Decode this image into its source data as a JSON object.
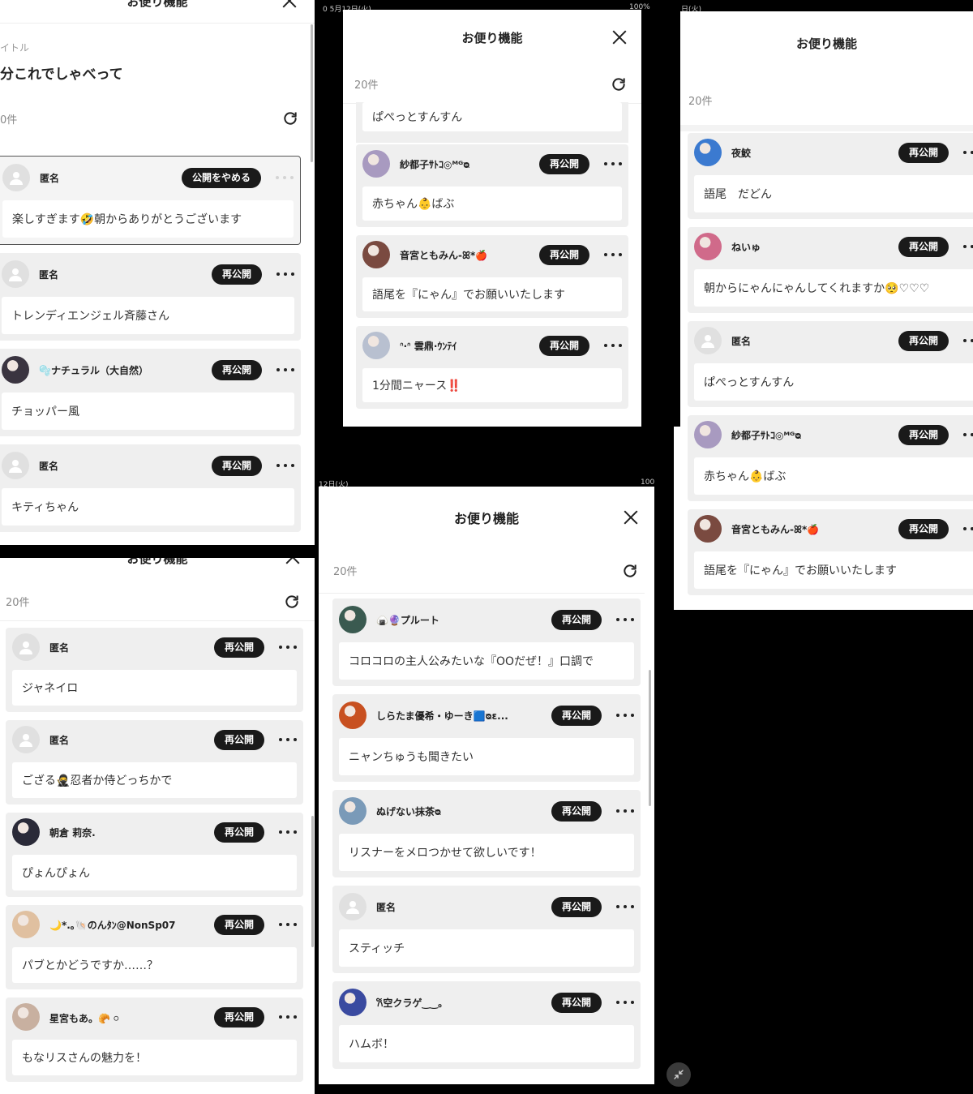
{
  "modal_title": "お便り機能",
  "count_label": "20件",
  "republish_label": "再公開",
  "stop_publish_label": "公開をやめる",
  "colors": {
    "pill": "#1a1a1a",
    "card": "#efefef",
    "bg": "#000000"
  },
  "status_bars": {
    "top_left": "0  5月12日(火)",
    "top_right": "100%",
    "top_far": "日(火)",
    "mid_left": "12日(火)",
    "mid_right": "100"
  },
  "panel1": {
    "header": "お便り機能",
    "title_label": "イトル",
    "title_value": "分これでしゃべって",
    "count": "0件",
    "items": [
      {
        "name": "匿名",
        "avatar": "anon",
        "button": "公開をやめる",
        "message": "楽しすぎます🤣朝からありがとうございます"
      },
      {
        "name": "匿名",
        "avatar": "anon",
        "button": "再公開",
        "message": "トレンディエンジェル斉藤さん"
      },
      {
        "name": "🫧ナチュラル（大自然）",
        "avatar": "img",
        "avatar_color": "#3a3440",
        "button": "再公開",
        "message": "チョッパー風"
      },
      {
        "name": "匿名",
        "avatar": "anon",
        "button": "再公開",
        "message": "キティちゃん"
      }
    ]
  },
  "panel2": {
    "header": "お便り機能",
    "count": "20件",
    "top_message": "ぱぺっとすんすん",
    "items": [
      {
        "name": "紗都子ｻﾄｺ◎ᴹᴳᴓ",
        "avatar": "img",
        "avatar_color": "#a89ac0",
        "button": "再公開",
        "message": "赤ちゃん👶ばぶ"
      },
      {
        "name": "音宮ともみん-ꕤ*🍎",
        "avatar": "img",
        "avatar_color": "#7a4a40",
        "button": "再公開",
        "message": "語尾を『にゃん』でお願いいたします"
      },
      {
        "name": "ᐢ‧ᐢ 雲鼎·ｳﾝﾃｲ",
        "avatar": "img",
        "avatar_color": "#b8c0d0",
        "button": "再公開",
        "message": "1分間ニャース‼️"
      }
    ]
  },
  "panel3": {
    "header": "お便り機能",
    "count": "20件",
    "items": [
      {
        "name": "夜鮫",
        "avatar": "img",
        "avatar_color": "#3b7ad0",
        "button": "再公開",
        "message": "語尾　だどん"
      },
      {
        "name": "ねいゅ",
        "avatar": "img",
        "avatar_color": "#d06a8a",
        "button": "再公開",
        "message": "朝からにゃんにゃんしてくれますか🥺♡♡♡"
      },
      {
        "name": "匿名",
        "avatar": "anon",
        "button": "再公開",
        "message": "ぱぺっとすんすん"
      },
      {
        "name": "紗都子ｻﾄｺ◎ᴹᴳᴓ",
        "avatar": "img",
        "avatar_color": "#a89ac0",
        "button": "再公開",
        "message": "赤ちゃん👶ばぶ"
      },
      {
        "name": "音宮ともみん-ꕤ*🍎",
        "avatar": "img",
        "avatar_color": "#7a4a40",
        "button": "再公開",
        "message": "語尾を『にゃん』でお願いいたします"
      }
    ]
  },
  "panel4": {
    "header": "お便り機能",
    "count": "20件",
    "items": [
      {
        "name": "匿名",
        "avatar": "anon",
        "button": "再公開",
        "message": "ジャネイロ"
      },
      {
        "name": "匿名",
        "avatar": "anon",
        "button": "再公開",
        "message": "ござる🥷忍者か侍どっちかで"
      },
      {
        "name": "朝倉 莉奈.",
        "avatar": "img",
        "avatar_color": "#2a2a38",
        "button": "再公開",
        "message": "ぴょんぴょん"
      },
      {
        "name": "🌙*.｡🐚のんﾀﾝ@NonSp07",
        "avatar": "img",
        "avatar_color": "#e0c0a0",
        "button": "再公開",
        "message": "パブとかどうですか……？"
      },
      {
        "name": "星宮もあ。🥐 𓏸",
        "avatar": "img",
        "avatar_color": "#c8b0a0",
        "button": "再公開",
        "message": "もなリスさんの魅力を！"
      }
    ]
  },
  "panel5": {
    "header": "お便り機能",
    "count": "20件",
    "items": [
      {
        "name": "🍙🔮プルート",
        "avatar": "img",
        "avatar_color": "#3a5a50",
        "button": "再公開",
        "message": "コロコロの主人公みたいな『OOだぜ！』口調で"
      },
      {
        "name": "しらたま優希・ゆーき🟦ᴓε...",
        "avatar": "img",
        "avatar_color": "#c85020",
        "button": "再公開",
        "message": "ニャンちゅうも聞きたい"
      },
      {
        "name": "ぬげない抹茶ᴓ",
        "avatar": "img",
        "avatar_color": "#7a9ab8",
        "button": "再公開",
        "message": "リスナーをメロつかせて欲しいです！"
      },
      {
        "name": "匿名",
        "avatar": "anon",
        "button": "再公開",
        "message": "スティッチ"
      },
      {
        "name": "𐙚空クラゲ‿‿｡",
        "avatar": "img",
        "avatar_color": "#3a4aa0",
        "button": "再公開",
        "message": "ハムボ！"
      }
    ]
  }
}
